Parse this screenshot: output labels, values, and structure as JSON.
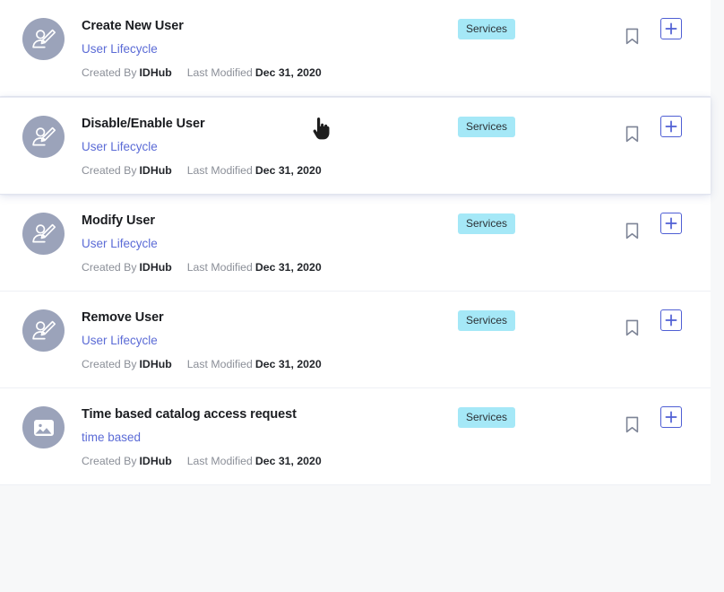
{
  "theme": {
    "page_background": "#f7f8f9",
    "card_background": "#ffffff",
    "title_color": "#1b1d21",
    "subtitle_link_color": "#5b6bd6",
    "meta_label_color": "#8b8f98",
    "meta_value_color": "#23262b",
    "badge_background": "#a5e8f7",
    "badge_text_color": "#2c3136",
    "avatar_background": "#9ba3ba",
    "bookmark_icon_color": "#7d8496",
    "add_button_border_color": "#4f5fd4",
    "add_button_plus_color": "#4f5fd4"
  },
  "labels": {
    "created_by": "Created By",
    "last_modified": "Last Modified"
  },
  "icons": {
    "avatar_user_edit": "user-edit-icon",
    "avatar_image": "image-placeholder-icon",
    "bookmark": "bookmark-icon",
    "add": "plus-icon",
    "cursor": "pointer-hand-cursor"
  },
  "catalog": {
    "items": [
      {
        "title": "Create New User",
        "subtitle": "User Lifecycle",
        "created_by": "IDHub",
        "last_modified": "Dec 31, 2020",
        "badge": "Services",
        "avatar_icon": "user-edit-icon",
        "hovered": false
      },
      {
        "title": "Disable/Enable User",
        "subtitle": "User Lifecycle",
        "created_by": "IDHub",
        "last_modified": "Dec 31, 2020",
        "badge": "Services",
        "avatar_icon": "user-edit-icon",
        "hovered": true
      },
      {
        "title": "Modify User",
        "subtitle": "User Lifecycle",
        "created_by": "IDHub",
        "last_modified": "Dec 31, 2020",
        "badge": "Services",
        "avatar_icon": "user-edit-icon",
        "hovered": false
      },
      {
        "title": "Remove User",
        "subtitle": "User Lifecycle",
        "created_by": "IDHub",
        "last_modified": "Dec 31, 2020",
        "badge": "Services",
        "avatar_icon": "user-edit-icon",
        "hovered": false
      },
      {
        "title": "Time based catalog access request",
        "subtitle": "time based",
        "created_by": "IDHub",
        "last_modified": "Dec 31, 2020",
        "badge": "Services",
        "avatar_icon": "image-placeholder-icon",
        "hovered": false
      }
    ]
  }
}
